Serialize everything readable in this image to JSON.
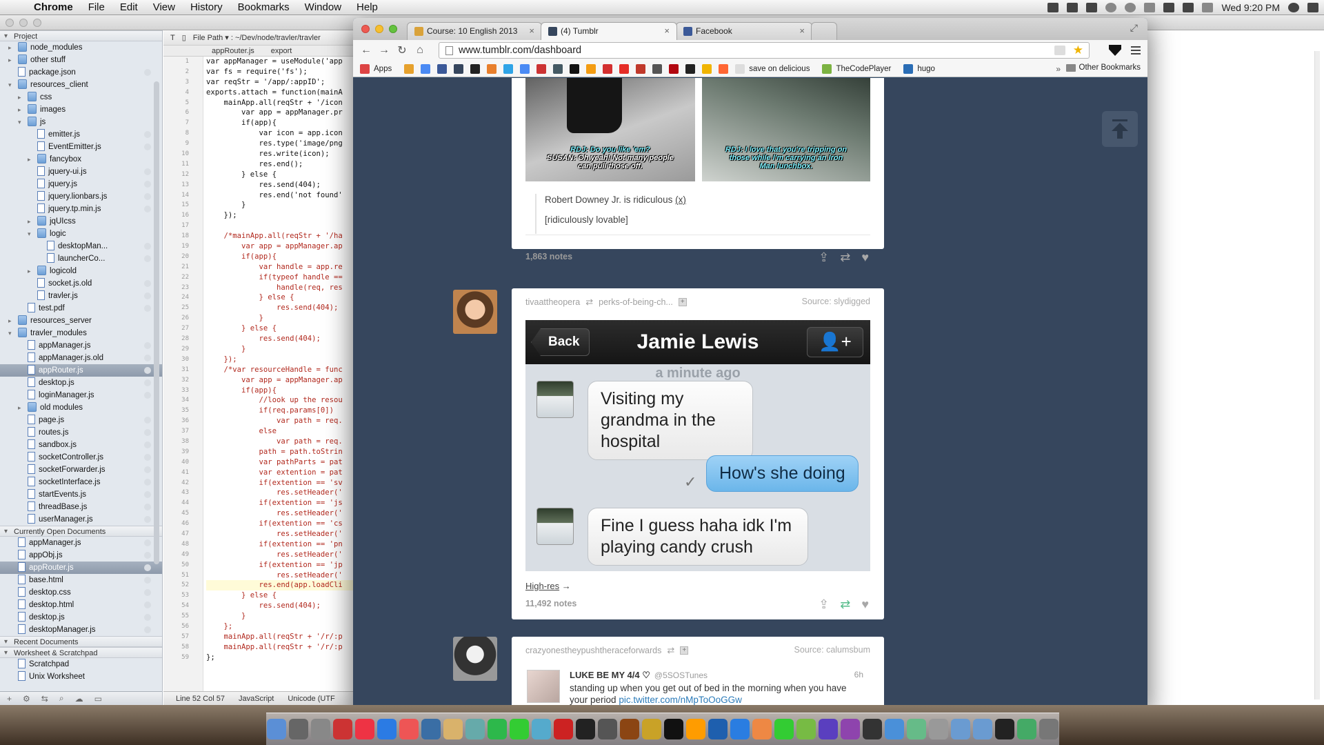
{
  "menubar": {
    "app": "Chrome",
    "items": [
      "File",
      "Edit",
      "View",
      "History",
      "Bookmarks",
      "Window",
      "Help"
    ],
    "clock": "Wed 9:20 PM"
  },
  "ide": {
    "project_header": "Project",
    "toolbar_file_path": "File Path ▾ : ~/Dev/node/travler/travler",
    "tab_label": "appRouter.js",
    "tab_label_2": "export",
    "status": {
      "position": "Line 52 Col 57",
      "language": "JavaScript",
      "encoding": "Unicode (UTF"
    },
    "project_tree": [
      {
        "label": "node_modules",
        "type": "folder",
        "depth": 1,
        "twisty": "▸"
      },
      {
        "label": "other stuff",
        "type": "folder",
        "depth": 1,
        "twisty": "▸"
      },
      {
        "label": "package.json",
        "type": "file",
        "depth": 1
      },
      {
        "label": "resources_client",
        "type": "folder",
        "depth": 1,
        "twisty": "▾"
      },
      {
        "label": "css",
        "type": "folder",
        "depth": 2,
        "twisty": "▸"
      },
      {
        "label": "images",
        "type": "folder",
        "depth": 2,
        "twisty": "▸"
      },
      {
        "label": "js",
        "type": "folder",
        "depth": 2,
        "twisty": "▾"
      },
      {
        "label": "emitter.js",
        "type": "file",
        "depth": 3
      },
      {
        "label": "EventEmitter.js",
        "type": "file",
        "depth": 3
      },
      {
        "label": "fancybox",
        "type": "folder",
        "depth": 3,
        "twisty": "▸"
      },
      {
        "label": "jquery-ui.js",
        "type": "file",
        "depth": 3
      },
      {
        "label": "jquery.js",
        "type": "file",
        "depth": 3
      },
      {
        "label": "jquery.lionbars.js",
        "type": "file",
        "depth": 3
      },
      {
        "label": "jquery.tp.min.js",
        "type": "file",
        "depth": 3
      },
      {
        "label": "jqUIcss",
        "type": "folder",
        "depth": 3,
        "twisty": "▸"
      },
      {
        "label": "logic",
        "type": "folder",
        "depth": 3,
        "twisty": "▾"
      },
      {
        "label": "desktopMan...",
        "type": "file",
        "depth": 4
      },
      {
        "label": "launcherCo...",
        "type": "file",
        "depth": 4
      },
      {
        "label": "logicold",
        "type": "folder",
        "depth": 3,
        "twisty": "▸"
      },
      {
        "label": "socket.js.old",
        "type": "file",
        "depth": 3
      },
      {
        "label": "travler.js",
        "type": "file",
        "depth": 3
      },
      {
        "label": "test.pdf",
        "type": "file",
        "depth": 2
      },
      {
        "label": "resources_server",
        "type": "folder",
        "depth": 1,
        "twisty": "▸"
      },
      {
        "label": "travler_modules",
        "type": "folder",
        "depth": 1,
        "twisty": "▾"
      },
      {
        "label": "appManager.js",
        "type": "file",
        "depth": 2
      },
      {
        "label": "appManager.js.old",
        "type": "file",
        "depth": 2
      },
      {
        "label": "appRouter.js",
        "type": "file",
        "depth": 2,
        "selected": true
      },
      {
        "label": "desktop.js",
        "type": "file",
        "depth": 2
      },
      {
        "label": "loginManager.js",
        "type": "file",
        "depth": 2
      },
      {
        "label": "old modules",
        "type": "folder",
        "depth": 2,
        "twisty": "▸"
      },
      {
        "label": "page.js",
        "type": "file",
        "depth": 2
      },
      {
        "label": "routes.js",
        "type": "file",
        "depth": 2
      },
      {
        "label": "sandbox.js",
        "type": "file",
        "depth": 2
      },
      {
        "label": "socketController.js",
        "type": "file",
        "depth": 2
      },
      {
        "label": "socketForwarder.js",
        "type": "file",
        "depth": 2
      },
      {
        "label": "socketInterface.js",
        "type": "file",
        "depth": 2
      },
      {
        "label": "startEvents.js",
        "type": "file",
        "depth": 2
      },
      {
        "label": "threadBase.js",
        "type": "file",
        "depth": 2
      },
      {
        "label": "userManager.js",
        "type": "file",
        "depth": 2
      }
    ],
    "open_docs_header": "Currently Open Documents",
    "open_docs": [
      {
        "label": "appManager.js"
      },
      {
        "label": "appObj.js"
      },
      {
        "label": "appRouter.js",
        "selected": true
      },
      {
        "label": "base.html"
      },
      {
        "label": "desktop.css"
      },
      {
        "label": "desktop.html"
      },
      {
        "label": "desktop.js"
      },
      {
        "label": "desktopManager.js"
      }
    ],
    "recent_header": "Recent Documents",
    "worksheet_header": "Worksheet & Scratchpad",
    "worksheets": [
      {
        "label": "Scratchpad"
      },
      {
        "label": "Unix Worksheet"
      }
    ],
    "code_lines": [
      {
        "text": "var appManager = useModule('app",
        "red": false
      },
      {
        "text": "var fs = require('fs');",
        "red": false
      },
      {
        "text": "var reqStr = '/app/:appID';",
        "red": false
      },
      {
        "text": "exports.attach = function(mainA",
        "red": false
      },
      {
        "text": "    mainApp.all(reqStr + '/icon",
        "red": false
      },
      {
        "text": "        var app = appManager.pr",
        "red": false
      },
      {
        "text": "        if(app){",
        "red": false
      },
      {
        "text": "            var icon = app.icon",
        "red": false
      },
      {
        "text": "            res.type('image/png",
        "red": false
      },
      {
        "text": "            res.write(icon);",
        "red": false
      },
      {
        "text": "            res.end();",
        "red": false
      },
      {
        "text": "        } else {",
        "red": false
      },
      {
        "text": "            res.send(404);",
        "red": false
      },
      {
        "text": "            res.end('not found'",
        "red": false
      },
      {
        "text": "        }",
        "red": false
      },
      {
        "text": "    });",
        "red": false
      },
      {
        "text": "",
        "red": false
      },
      {
        "text": "    /*mainApp.all(reqStr + '/ha",
        "red": true
      },
      {
        "text": "        var app = appManager.ap",
        "red": true
      },
      {
        "text": "        if(app){",
        "red": true
      },
      {
        "text": "            var handle = app.re",
        "red": true
      },
      {
        "text": "            if(typeof handle ==",
        "red": true
      },
      {
        "text": "                handle(req, res",
        "red": true
      },
      {
        "text": "            } else {",
        "red": true
      },
      {
        "text": "                res.send(404);",
        "red": true
      },
      {
        "text": "            }",
        "red": true
      },
      {
        "text": "        } else {",
        "red": true
      },
      {
        "text": "            res.send(404);",
        "red": true
      },
      {
        "text": "        }",
        "red": true
      },
      {
        "text": "    });",
        "red": true
      },
      {
        "text": "    /*var resourceHandle = func",
        "red": true
      },
      {
        "text": "        var app = appManager.ap",
        "red": true
      },
      {
        "text": "        if(app){",
        "red": true
      },
      {
        "text": "            //look up the resou",
        "red": true
      },
      {
        "text": "            if(req.params[0])",
        "red": true
      },
      {
        "text": "                var path = req.",
        "red": true
      },
      {
        "text": "            else",
        "red": true
      },
      {
        "text": "                var path = req.",
        "red": true
      },
      {
        "text": "            path = path.toStrin",
        "red": true
      },
      {
        "text": "            var pathParts = pat",
        "red": true
      },
      {
        "text": "            var extention = pat",
        "red": true
      },
      {
        "text": "            if(extention == 'sv",
        "red": true
      },
      {
        "text": "                res.setHeader('",
        "red": true
      },
      {
        "text": "            if(extention == 'js",
        "red": true
      },
      {
        "text": "                res.setHeader('",
        "red": true
      },
      {
        "text": "            if(extention == 'cs",
        "red": true
      },
      {
        "text": "                res.setHeader('",
        "red": true
      },
      {
        "text": "            if(extention == 'pn",
        "red": true
      },
      {
        "text": "                res.setHeader('",
        "red": true
      },
      {
        "text": "            if(extention == 'jp",
        "red": true
      },
      {
        "text": "                res.setHeader('",
        "red": true
      },
      {
        "text": "            res.end(app.loadCli",
        "red": true,
        "hl": true
      },
      {
        "text": "        } else {",
        "red": true
      },
      {
        "text": "            res.send(404);",
        "red": true
      },
      {
        "text": "        }",
        "red": true
      },
      {
        "text": "    };",
        "red": true
      },
      {
        "text": "    mainApp.all(reqStr + '/r/:p",
        "red": true
      },
      {
        "text": "    mainApp.all(reqStr + '/r/:p",
        "red": true
      },
      {
        "text": "};",
        "red": false
      }
    ]
  },
  "browser": {
    "tabs": [
      {
        "label": "Course: 10 English 2013",
        "favicon_color": "#d9a23a"
      },
      {
        "label": "(4) Tumblr",
        "favicon_color": "#36465d"
      },
      {
        "label": "Facebook",
        "favicon_color": "#3b5998"
      }
    ],
    "url": "www.tumblr.com/dashboard",
    "bookmarks": [
      {
        "label": "Apps",
        "color": "#d44"
      },
      {
        "label": "",
        "color": "#e6a12d"
      },
      {
        "label": "",
        "color": "#4a8af4"
      },
      {
        "label": "",
        "color": "#3b5998"
      },
      {
        "label": "",
        "color": "#36465d"
      },
      {
        "label": "",
        "color": "#222"
      },
      {
        "label": "",
        "color": "#e87f2c"
      },
      {
        "label": "",
        "color": "#2fa4e7"
      },
      {
        "label": "",
        "color": "#4a8af4"
      },
      {
        "label": "",
        "color": "#c33"
      },
      {
        "label": "",
        "color": "#455a64"
      },
      {
        "label": "",
        "color": "#111"
      },
      {
        "label": "",
        "color": "#f39c12"
      },
      {
        "label": "",
        "color": "#d32f2f"
      },
      {
        "label": "",
        "color": "#e52d27"
      },
      {
        "label": "",
        "color": "#c0392b"
      },
      {
        "label": "",
        "color": "#555"
      },
      {
        "label": "",
        "color": "#b20710"
      },
      {
        "label": "",
        "color": "#222"
      },
      {
        "label": "",
        "color": "#f0b400"
      },
      {
        "label": "",
        "color": "#ff6633"
      },
      {
        "label": "save on delicious",
        "color": "#ddd"
      },
      {
        "label": "TheCodePlayer",
        "color": "#7cb342"
      },
      {
        "label": "hugo",
        "color": "#2a6db5"
      }
    ],
    "bookmarks_more": "»",
    "other_bookmarks": "Other Bookmarks"
  },
  "posts": [
    {
      "gif_captions": [
        {
          "line1": "RDJ: Do you like 'em?",
          "line2": "SUSAN: Oh yeah! Not many people",
          "line3": "can pull those off."
        },
        {
          "line1": "RDJ: I love that you're tripping on",
          "line2": "those while I'm carrying an Iron",
          "line3": "Man lunchbox."
        }
      ],
      "quote_line1": "Robert Downey Jr. is ridiculous",
      "quote_link": "(x)",
      "quote_line2": "[ridiculously lovable]",
      "notes": "1,863 notes"
    },
    {
      "blog": "tivaattheopera",
      "reblogged_from": "perks-of-being-ch...",
      "source": "Source: slydigged",
      "phone": {
        "back": "Back",
        "contact": "Jamie Lewis",
        "time": "a minute ago",
        "msg1": "Visiting my grandma in the hospital",
        "msg2": "How's she doing",
        "msg3": "Fine I guess haha idk I'm playing candy crush"
      },
      "highres": "High-res",
      "notes": "11,492 notes"
    },
    {
      "blog": "crazyonestheypushtheraceforwards",
      "source": "Source: calumsbum",
      "tweet_name": "LUKE BE MY 4/4 ♡",
      "tweet_handle": "@5SOSTunes",
      "tweet_time": "6h",
      "tweet_text": "standing up when you get out of bed in the morning when you have your period",
      "tweet_link": "pic.twitter.com/nMpToOoGGw"
    }
  ]
}
